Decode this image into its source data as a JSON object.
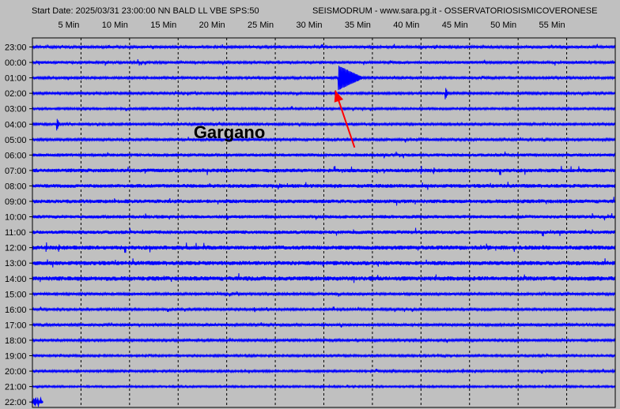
{
  "header": {
    "start_info": "Start Date: 2025/03/31 23:00:00 NN BALD LL VBE SPS:50",
    "source_info": "SEISMODRUM - www.sara.pg.it - OSSERVATORIOSISMICOVERONESE"
  },
  "colors": {
    "background": "#c0c0c0",
    "trace": "#0000ff",
    "grid": "#000000",
    "arrow": "#ff0000"
  },
  "chart_data": {
    "type": "line",
    "title": "",
    "xlabel": "",
    "ylabel": "",
    "x_unit": "minutes",
    "xlim": [
      0,
      60
    ],
    "x_ticks": [
      5,
      10,
      15,
      20,
      25,
      30,
      35,
      40,
      45,
      50,
      55
    ],
    "x_tick_labels": [
      "5 Min",
      "10 Min",
      "15 Min",
      "20 Min",
      "25 Min",
      "30 Min",
      "35 Min",
      "40 Min",
      "45 Min",
      "50 Min",
      "55 Min"
    ],
    "grid": true,
    "rows": [
      "23:00",
      "00:00",
      "01:00",
      "02:00",
      "03:00",
      "04:00",
      "05:00",
      "06:00",
      "07:00",
      "08:00",
      "09:00",
      "10:00",
      "11:00",
      "12:00",
      "13:00",
      "14:00",
      "15:00",
      "16:00",
      "17:00",
      "18:00",
      "19:00",
      "20:00",
      "21:00",
      "22:00"
    ],
    "row_noise_level": [
      0.55,
      0.6,
      0.5,
      0.5,
      0.45,
      0.5,
      0.55,
      0.7,
      0.85,
      0.85,
      0.85,
      0.75,
      0.8,
      0.95,
      0.95,
      1.0,
      0.55,
      0.5,
      0.55,
      0.5,
      0.45,
      0.45,
      0.4,
      0.6
    ],
    "partial_last_row_minutes": 1,
    "events": [
      {
        "row": "01:00",
        "minute": 31.5,
        "amplitude": 4.5,
        "duration_min": 2.5
      },
      {
        "row": "02:00",
        "minute": 42.5,
        "amplitude": 2.0,
        "duration_min": 0.3
      },
      {
        "row": "04:00",
        "minute": 2.5,
        "amplitude": 2.2,
        "duration_min": 0.3
      }
    ],
    "annotations": [
      {
        "text": "Gargano",
        "row": "05:00",
        "minute": 17
      }
    ]
  }
}
